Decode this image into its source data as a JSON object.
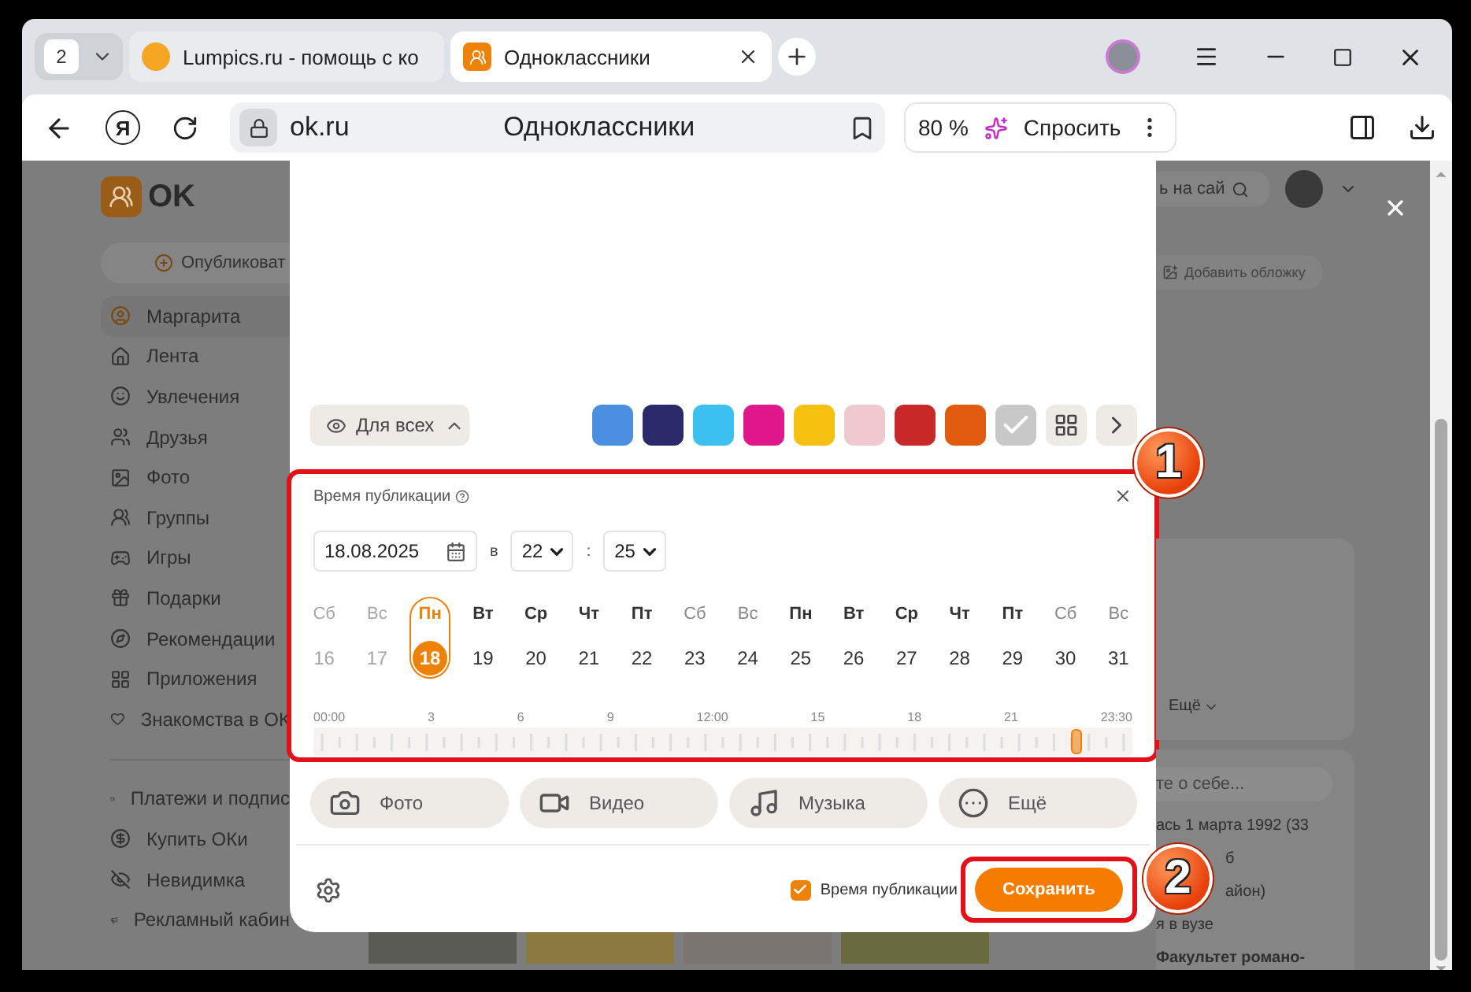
{
  "browser": {
    "tab_count": "2",
    "tabs": [
      {
        "title": "Lumpics.ru - помощь с ко",
        "selected": false
      },
      {
        "title": "Одноклассники",
        "selected": true
      }
    ],
    "home_glyph": "Я",
    "address": "ok.ru",
    "page_title": "Одноклассники",
    "zoom": "80 %",
    "ask": "Спросить"
  },
  "sidebar": {
    "logo": "OK",
    "publish": "Опубликоват",
    "items": [
      {
        "label": "Маргарита",
        "selected": true
      },
      {
        "label": "Лента",
        "selected": false
      },
      {
        "label": "Увлечения",
        "selected": false
      },
      {
        "label": "Друзья",
        "selected": false
      },
      {
        "label": "Фото",
        "selected": false
      },
      {
        "label": "Группы",
        "selected": false
      },
      {
        "label": "Игры",
        "selected": false
      },
      {
        "label": "Подарки",
        "selected": false
      },
      {
        "label": "Рекомендации",
        "selected": false
      },
      {
        "label": "Приложения",
        "selected": false
      },
      {
        "label": "Знакомства в ОК",
        "selected": false
      }
    ],
    "extra_items": [
      {
        "label": "Платежи и подпис"
      },
      {
        "label": "Купить ОКи"
      },
      {
        "label": "Невидимка"
      },
      {
        "label": "Рекламный кабин"
      }
    ]
  },
  "right": {
    "search": "ь на сай",
    "cover": "Добавить обложку",
    "more": "Ещё",
    "about_placeholder": "те о себе...",
    "lines": [
      "ась 1 марта 1992 (33",
      "б",
      "айон)",
      "я в вузе",
      "Факультет романо-"
    ]
  },
  "modal": {
    "visibility": "Для всех",
    "backgrounds": [
      {
        "color": "#4a8fe0",
        "selected": false
      },
      {
        "color": "#2a2a6a",
        "selected": false
      },
      {
        "color": "#3cc0f0",
        "selected": false
      },
      {
        "color": "#e0188c",
        "selected": false
      },
      {
        "color": "#f5c010",
        "selected": false
      },
      {
        "color": "#f0c8d0",
        "selected": false
      },
      {
        "color": "#c82828",
        "selected": false
      },
      {
        "color": "#e05a10",
        "selected": false
      },
      {
        "color": "#c8c8c8",
        "selected": true
      }
    ],
    "schedule": {
      "title": "Время публикации",
      "date": "18.08.2025",
      "at": "в",
      "hour": "22",
      "separator": ":",
      "minute": "25",
      "days": [
        {
          "weekday": "Сб",
          "day": "16",
          "past": true,
          "weekend": true,
          "selected": false
        },
        {
          "weekday": "Вс",
          "day": "17",
          "past": true,
          "weekend": true,
          "selected": false
        },
        {
          "weekday": "Пн",
          "day": "18",
          "past": false,
          "weekend": false,
          "selected": true
        },
        {
          "weekday": "Вт",
          "day": "19",
          "past": false,
          "weekend": false,
          "selected": false
        },
        {
          "weekday": "Ср",
          "day": "20",
          "past": false,
          "weekend": false,
          "selected": false
        },
        {
          "weekday": "Чт",
          "day": "21",
          "past": false,
          "weekend": false,
          "selected": false
        },
        {
          "weekday": "Пт",
          "day": "22",
          "past": false,
          "weekend": false,
          "selected": false
        },
        {
          "weekday": "Сб",
          "day": "23",
          "past": false,
          "weekend": true,
          "selected": false
        },
        {
          "weekday": "Вс",
          "day": "24",
          "past": false,
          "weekend": true,
          "selected": false
        },
        {
          "weekday": "Пн",
          "day": "25",
          "past": false,
          "weekend": false,
          "selected": false
        },
        {
          "weekday": "Вт",
          "day": "26",
          "past": false,
          "weekend": false,
          "selected": false
        },
        {
          "weekday": "Ср",
          "day": "27",
          "past": false,
          "weekend": false,
          "selected": false
        },
        {
          "weekday": "Чт",
          "day": "28",
          "past": false,
          "weekend": false,
          "selected": false
        },
        {
          "weekday": "Пт",
          "day": "29",
          "past": false,
          "weekend": false,
          "selected": false
        },
        {
          "weekday": "Сб",
          "day": "30",
          "past": false,
          "weekend": true,
          "selected": false
        },
        {
          "weekday": "Вс",
          "day": "31",
          "past": false,
          "weekend": true,
          "selected": false
        }
      ],
      "time_labels": [
        "00:00",
        "3",
        "6",
        "9",
        "12:00",
        "15",
        "18",
        "21",
        "23:30"
      ],
      "level": 0.93
    },
    "attachments": [
      {
        "kind": "photo",
        "label": "Фото"
      },
      {
        "kind": "video",
        "label": "Видео"
      },
      {
        "kind": "music",
        "label": "Музыка"
      },
      {
        "kind": "more",
        "label": "Ещё"
      }
    ],
    "publish_time": {
      "checked": true,
      "label": "Время публикации"
    },
    "save": "Сохранить"
  },
  "markers": [
    "1",
    "2"
  ]
}
